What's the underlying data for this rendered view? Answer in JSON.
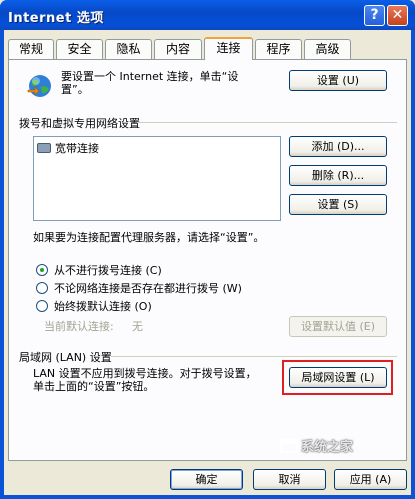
{
  "window": {
    "title": "Internet 选项",
    "help_label": "?",
    "close_label": "✕"
  },
  "tabs": [
    {
      "label": "常规"
    },
    {
      "label": "安全"
    },
    {
      "label": "隐私"
    },
    {
      "label": "内容"
    },
    {
      "label": "连接"
    },
    {
      "label": "程序"
    },
    {
      "label": "高级"
    }
  ],
  "active_tab": "连接",
  "setup": {
    "text": "要设置一个 Internet 连接，单击“设置”。",
    "button": "设置 (U)"
  },
  "dialup": {
    "group_label": "拨号和虚拟专用网络设置",
    "connections": [
      "宽带连接"
    ],
    "add_button": "添加 (D)...",
    "remove_button": "删除 (R)...",
    "settings_button": "设置 (S)",
    "proxy_text": "如果要为连接配置代理服务器，请选择“设置”。",
    "options": [
      {
        "label": "从不进行拨号连接 (C)",
        "selected": true
      },
      {
        "label": "不论网络连接是否存在都进行拨号 (W)",
        "selected": false
      },
      {
        "label": "始终拨默认连接 (O)",
        "selected": false
      }
    ],
    "current_default_label": "当前默认连接:",
    "current_default_value": "无",
    "set_default_button": "设置默认值 (E)"
  },
  "lan": {
    "group_label": "局域网 (LAN) 设置",
    "text": "LAN 设置不应用到拨号连接。对于拨号设置，单击上面的“设置”按钮。",
    "button": "局域网设置 (L)"
  },
  "footer": {
    "ok": "确定",
    "cancel": "取消",
    "apply": "应用 (A)"
  },
  "watermark": "系统之家",
  "colors": {
    "title_bar": "#0550d8",
    "highlight_box": "#e02020",
    "active_tab_accent": "#f0a33a"
  }
}
